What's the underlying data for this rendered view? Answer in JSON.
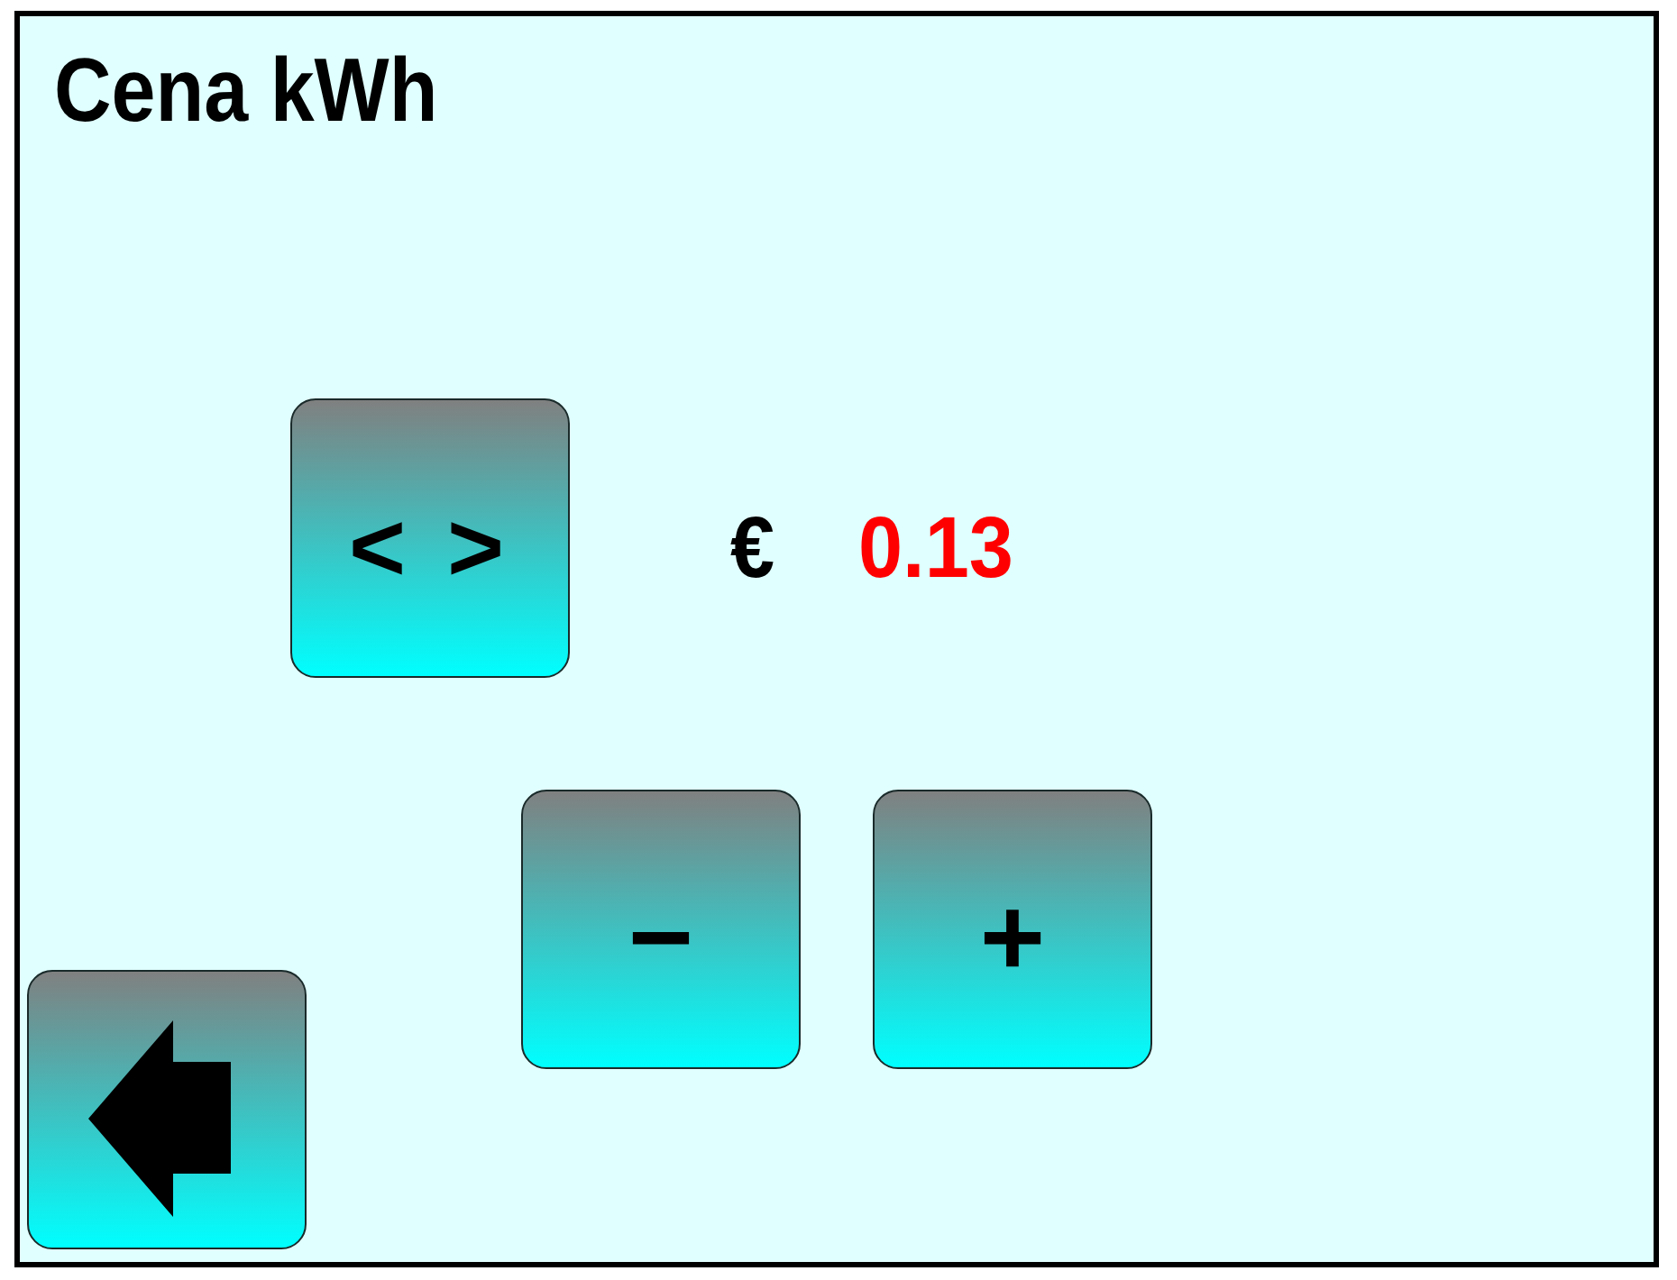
{
  "screen": {
    "title": "Cena kWh"
  },
  "toggle_button": {
    "label": "< >"
  },
  "price": {
    "currency": "€",
    "value": "0.13"
  },
  "step_buttons": [
    {
      "label": "−"
    },
    {
      "label": "+"
    }
  ]
}
